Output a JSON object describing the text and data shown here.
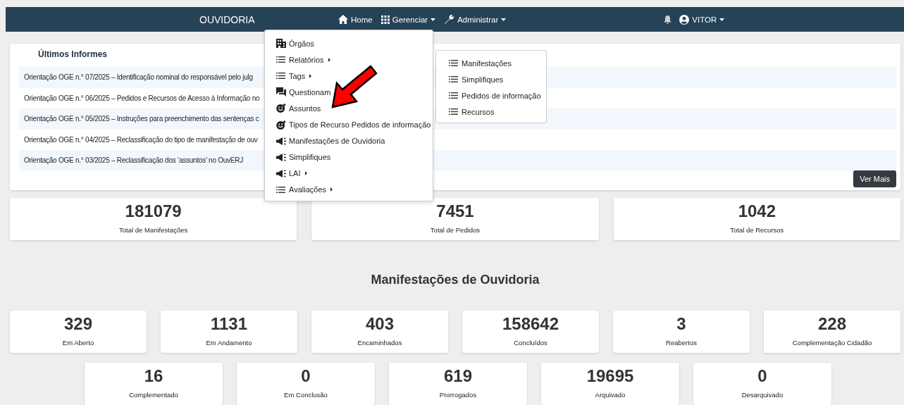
{
  "navbar": {
    "brand": "OUVIDORIA",
    "items": [
      {
        "label": "Home",
        "has_caret": false
      },
      {
        "label": "Gerenciar",
        "has_caret": true
      },
      {
        "label": "Administrar",
        "has_caret": true
      }
    ],
    "user": {
      "name": "VITOR",
      "has_caret": true
    }
  },
  "gerenciar_menu": {
    "items": [
      {
        "label": "Órgãos",
        "has_submenu": false
      },
      {
        "label": "Relatórios",
        "has_submenu": true
      },
      {
        "label": "Tags",
        "has_submenu": true
      },
      {
        "label": "Questionam"
      },
      {
        "label": "Assuntos",
        "has_submenu": false
      },
      {
        "label": "Tipos de Recurso Pedidos de informação",
        "has_submenu": false
      },
      {
        "label": "Manifestações de Ouvidoria",
        "has_submenu": false
      },
      {
        "label": "Simplifiques",
        "has_submenu": false
      },
      {
        "label": "LAI",
        "has_submenu": true
      },
      {
        "label": "Avaliações",
        "has_submenu": true
      }
    ]
  },
  "relatorios_submenu": {
    "items": [
      "Manifestações",
      "Simplifiques",
      "Pedidos de informação",
      "Recursos"
    ]
  },
  "latest_reports": {
    "title": "Últimos Informes",
    "rows": [
      "Orientação OGE n.° 07/2025 – Identificação nominal do responsável pelo julg",
      "Orientação OGE n.° 06/2025 – Pedidos e Recursos de Acesso à Informação no",
      "Orientação OGE n.° 05/2025 – Instruções para preenchimento das sentenças c",
      "Orientação OGE n.° 04/2025 – Reclassificação do tipo de manifestação de ouv",
      "Orientação OGE n.° 03/2025 – Reclassificação dos ‘assuntos’ no OuvERJ"
    ],
    "button": "Ver Mais"
  },
  "totals": [
    {
      "value": "181079",
      "label": "Total de Manifestações"
    },
    {
      "value": "7451",
      "label": "Total de Pedidos"
    },
    {
      "value": "1042",
      "label": "Total de Recursos"
    }
  ],
  "section_title": "Manifestações de Ouvidoria",
  "status_cards": {
    "row_1": [
      {
        "value": "329",
        "label": "Em Aberto"
      },
      {
        "value": "1131",
        "label": "Em Andamento"
      },
      {
        "value": "403",
        "label": "Encaminhados"
      },
      {
        "value": "158642",
        "label": "Concluídos"
      },
      {
        "value": "3",
        "label": "Reabertos"
      },
      {
        "value": "228",
        "label": "Complementação Cidadão"
      }
    ],
    "row_2": [
      {
        "value": "16",
        "label": "Complementado"
      },
      {
        "value": "0",
        "label": "Em Conclusão"
      },
      {
        "value": "619",
        "label": "Prorrogados"
      },
      {
        "value": "19695",
        "label": "Arquivado"
      },
      {
        "value": "0",
        "label": "Desarquivado"
      }
    ]
  }
}
